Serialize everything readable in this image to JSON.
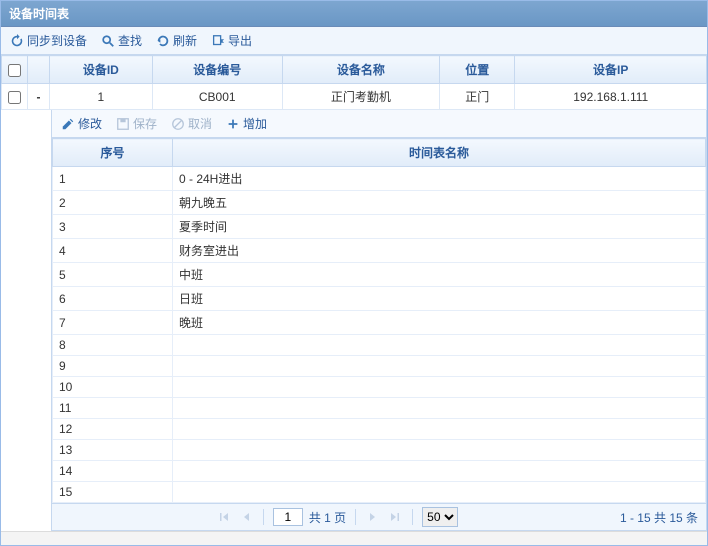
{
  "panel": {
    "title": "设备时间表"
  },
  "toolbar": {
    "sync": {
      "label": "同步到设备",
      "icon": "sync-icon"
    },
    "find": {
      "label": "查找",
      "icon": "search-icon"
    },
    "refresh": {
      "label": "刷新",
      "icon": "refresh-icon"
    },
    "export": {
      "label": "导出",
      "icon": "export-icon"
    }
  },
  "deviceGrid": {
    "columns": {
      "checkbox": "",
      "expander": "",
      "id": "设备ID",
      "code": "设备编号",
      "name": "设备名称",
      "location": "位置",
      "ip": "设备IP"
    },
    "row": {
      "id": "1",
      "code": "CB001",
      "name": "正门考勤机",
      "location": "正门",
      "ip": "192.168.1.111",
      "expander": "-"
    }
  },
  "subToolbar": {
    "edit": "修改",
    "save": "保存",
    "cancel": "取消",
    "add": "增加"
  },
  "subGrid": {
    "columns": {
      "seq": "序号",
      "name": "时间表名称"
    },
    "rows": [
      {
        "seq": "1",
        "name": "0 - 24H进出"
      },
      {
        "seq": "2",
        "name": "朝九晚五"
      },
      {
        "seq": "3",
        "name": "夏季时间"
      },
      {
        "seq": "4",
        "name": "财务室进出"
      },
      {
        "seq": "5",
        "name": "中班"
      },
      {
        "seq": "6",
        "name": "日班"
      },
      {
        "seq": "7",
        "name": "晚班"
      },
      {
        "seq": "8",
        "name": ""
      },
      {
        "seq": "9",
        "name": ""
      },
      {
        "seq": "10",
        "name": ""
      },
      {
        "seq": "11",
        "name": ""
      },
      {
        "seq": "12",
        "name": ""
      },
      {
        "seq": "13",
        "name": ""
      },
      {
        "seq": "14",
        "name": ""
      },
      {
        "seq": "15",
        "name": ""
      }
    ]
  },
  "paging": {
    "page": "1",
    "totalPagesText": "共 1 页",
    "pageSize": "50",
    "info": "1 - 15  共 15 条"
  }
}
